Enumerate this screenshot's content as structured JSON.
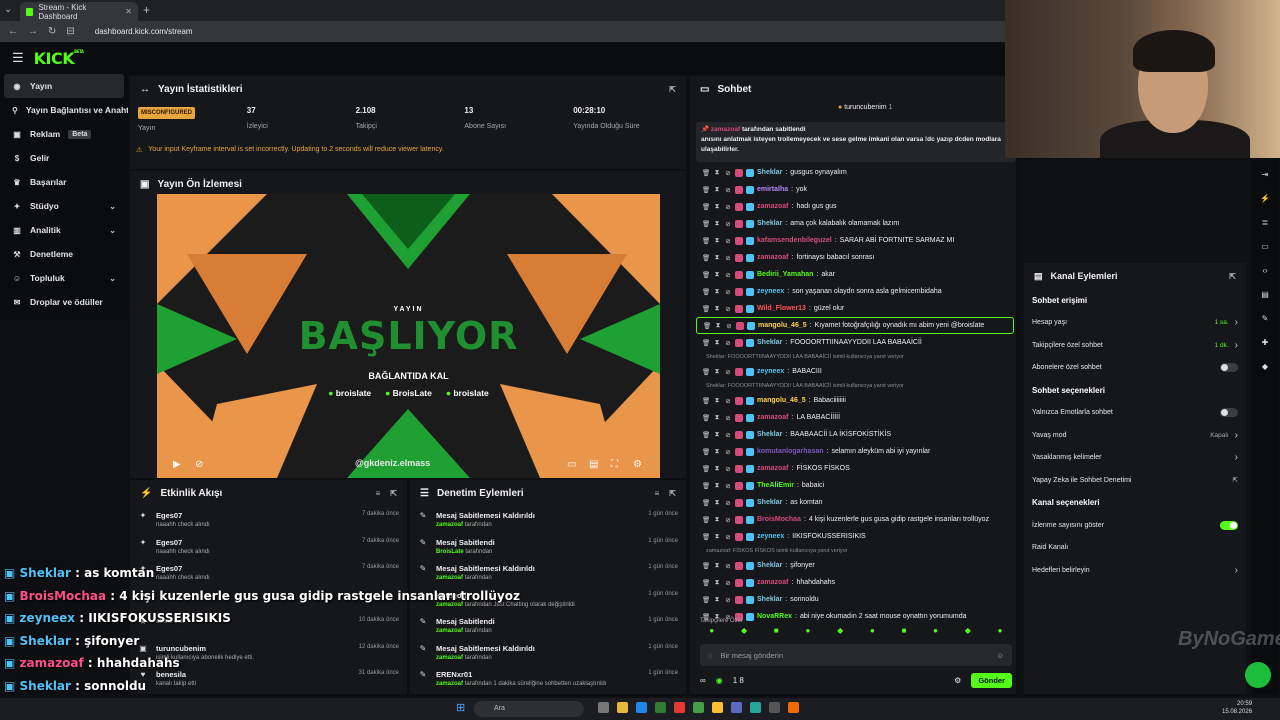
{
  "browser": {
    "tab_title": "Stream - Kick Dashboard",
    "url": "dashboard.kick.com/stream"
  },
  "brand": {
    "logo": "KICK",
    "beta": "BETA",
    "accent": "#53fc18"
  },
  "sidebar": {
    "items": [
      {
        "label": "Yayın",
        "icon": "broadcast-icon",
        "active": true
      },
      {
        "label": "Yayın Bağlantısı ve Anahtarı",
        "icon": "key-icon"
      },
      {
        "label": "Reklam",
        "icon": "ad-icon",
        "badge": "Beta"
      },
      {
        "label": "Gelir",
        "icon": "money-icon"
      },
      {
        "label": "Başarılar",
        "icon": "trophy-icon"
      },
      {
        "label": "Stüdyo",
        "icon": "studio-icon",
        "chevron": true
      },
      {
        "label": "Analitik",
        "icon": "chart-icon",
        "chevron": true
      },
      {
        "label": "Denetleme",
        "icon": "hammer-icon"
      },
      {
        "label": "Topluluk",
        "icon": "people-icon",
        "chevron": true
      },
      {
        "label": "Droplar ve ödüller",
        "icon": "gift-icon"
      }
    ]
  },
  "stats": {
    "title": "Yayın İstatistikleri",
    "status": "MISCONFIGURED",
    "items": [
      {
        "value": "",
        "label": "Yayın"
      },
      {
        "value": "37",
        "label": "İzleyici"
      },
      {
        "value": "2.108",
        "label": "Takipçi"
      },
      {
        "value": "13",
        "label": "Abone Sayısı"
      },
      {
        "value": "00:28:10",
        "label": "Yayında Olduğu Süre"
      }
    ],
    "warning": "Your input Keyframe interval is set incorrectly. Updating to 2 seconds will reduce viewer latency."
  },
  "preview": {
    "title": "Yayın Ön İzlemesi",
    "small": "YAYIN",
    "headline": "BAŞLIYOR",
    "sub": "BAĞLANTIDA KAL",
    "socials": [
      "broislate",
      "BroisLate",
      "broislate"
    ],
    "handle": "@gkdeniz.elmass"
  },
  "activity": {
    "title": "Etkinlik Akışı",
    "rows": [
      {
        "name": "Eges07",
        "detail": "naaahh check alındı",
        "time": "7 dakika önce"
      },
      {
        "name": "Eges07",
        "detail": "naaahh check alındı",
        "time": "7 dakika önce"
      },
      {
        "name": "Eges07",
        "detail": "naaahh check alındı",
        "time": "7 dakika önce"
      },
      {
        "name": "",
        "detail": "",
        "time": ""
      },
      {
        "name": "",
        "detail": "abone oldu",
        "time": "10 dakika önce"
      },
      {
        "name": "turuncubenim",
        "detail": "isimli kullanıcıya abonelik hediye etti.",
        "time": "12 dakika önce"
      },
      {
        "name": "benesila",
        "detail": "kanalı takip etti",
        "time": "31 dakika önce"
      }
    ]
  },
  "moderation": {
    "title": "Denetim Eylemleri",
    "rows": [
      {
        "action": "Mesaj Sabitlemesi Kaldırıldı",
        "by": "zamazoaf",
        "suffix": "tarafından",
        "time": "1 gün önce"
      },
      {
        "action": "Mesaj Sabitlendi",
        "by": "BroisLate",
        "suffix": "tarafından",
        "time": "1 gün önce"
      },
      {
        "action": "Mesaj Sabitlemesi Kaldırıldı",
        "by": "zamazoaf",
        "suffix": "tarafından",
        "time": "1 gün önce"
      },
      {
        "action": "Kategori",
        "by": "zamazoaf",
        "suffix": "tarafından Just Chatting olarak değiştirildi",
        "time": "1 gün önce"
      },
      {
        "action": "Mesaj Sabitlendi",
        "by": "zamazoaf",
        "suffix": "tarafından",
        "time": "1 gün önce"
      },
      {
        "action": "Mesaj Sabitlemesi Kaldırıldı",
        "by": "zamazoaf",
        "suffix": "tarafından",
        "time": "1 gün önce"
      },
      {
        "action": "ERENxr01",
        "by": "zamazoaf",
        "suffix": "tarafından 1 dakika süreliğine sohbetten uzaklaştırıldı",
        "time": "1 gün önce"
      }
    ]
  },
  "chat": {
    "title": "Sohbet",
    "top_user": "turuncubenim",
    "top_count": "1",
    "pinned_by": "tarafından sabitlendi",
    "pinned_text": "anısını anlatmak isteyen trollemeyecek ve sese gelme imkani olan varsa !dc yazıp dcden modlara ulaşabilirler.",
    "messages": [
      {
        "user": "Sheklar",
        "color": "#7ec8e3",
        "text": "gusgus oynayalım"
      },
      {
        "user": "emirtalha",
        "color": "#b28cff",
        "text": "yok"
      },
      {
        "user": "zamazoaf",
        "color": "#d54b7c",
        "text": "hadı gus gus"
      },
      {
        "user": "Sheklar",
        "color": "#7ec8e3",
        "text": "ama çok kalabalık olamamak lazım"
      },
      {
        "user": "kafamsendenbileguzel",
        "color": "#d54b7c",
        "text": "SARAR ABİ FORTNITE SARMAZ MI"
      },
      {
        "user": "zamazoaf",
        "color": "#d54b7c",
        "text": "fortinaysı babacıl sonrası"
      },
      {
        "user": "Bedirii_Yamahan",
        "color": "#53fc18",
        "text": "akar"
      },
      {
        "user": "zeyneex",
        "color": "#4fc3f7",
        "text": "son yaşanan olaydn sonra asla gelmicembidaha"
      },
      {
        "user": "Wild_Flower13",
        "color": "#ff5252",
        "text": "güzel olur"
      },
      {
        "user": "mangolu_46_5",
        "color": "#ffd54f",
        "text": "Kıyamet fotoğrafçılığı oynadık mı abim yeni @broislate",
        "hl": true
      },
      {
        "user": "Sheklar",
        "color": "#7ec8e3",
        "text": "FOOOORTTIINAAYYDDII LAA BABAAİCİİ"
      },
      {
        "reply": "Sheklar: FOOOORTTIINAAYYDDII LAA BABAAİCİİ isimli kullanıcıya yanıt veriyor"
      },
      {
        "user": "zeyneex",
        "color": "#4fc3f7",
        "text": "BABACIII"
      },
      {
        "reply": "Sheklar: FOOOORTTIINAAYYDDII LAA BABAAİCİİ isimli kullanıcıya yanıt veriyor"
      },
      {
        "user": "mangolu_46_5",
        "color": "#ffd54f",
        "text": "Babaciiiiiiii"
      },
      {
        "user": "zamazoaf",
        "color": "#d54b7c",
        "text": "LA BABACİİİİİ"
      },
      {
        "user": "Sheklar",
        "color": "#7ec8e3",
        "text": "BAABAACİİ LA İKİSFOKİSTİKİS"
      },
      {
        "user": "komutanlogarhasan",
        "color": "#7e57c2",
        "text": "selamın aleyküm abi iyi yayınlar"
      },
      {
        "user": "zamazoaf",
        "color": "#d54b7c",
        "text": "FİSKOS FİSKOS"
      },
      {
        "user": "TheAliEmir",
        "color": "#53fc18",
        "text": "babaici"
      },
      {
        "user": "Sheklar",
        "color": "#7ec8e3",
        "text": "as komtan"
      },
      {
        "user": "BroisMochaa",
        "color": "#d54b7c",
        "text": "4 kişi kuzenlerle gus gusa gidip rastgele insanları trollüyoz"
      },
      {
        "user": "zeyneex",
        "color": "#4fc3f7",
        "text": "IIKISFOKUSSERISIKIS"
      },
      {
        "reply": "zamazoaf: FİSKOS FİSKOS isimli kullanıcıya yanıt veriyor"
      },
      {
        "user": "Sheklar",
        "color": "#7ec8e3",
        "text": "şifonyer"
      },
      {
        "user": "zamazoaf",
        "color": "#d54b7c",
        "text": "hhahdahahs"
      },
      {
        "user": "Sheklar",
        "color": "#7ec8e3",
        "text": "sonnoldu"
      },
      {
        "user": "NovaRRex",
        "color": "#53fc18",
        "text": "abi niye okumadın 2 saat mouse oynattın yorumumda"
      }
    ],
    "followers_only": "Takipçilere Özel",
    "input_placeholder": "Bir mesaj gönderin",
    "points": "1 8",
    "send": "Gönder"
  },
  "channel_actions": {
    "title": "Kanal Eylemleri",
    "rows": [
      {
        "type": "sec",
        "label": "Sohbet erişimi"
      },
      {
        "type": "row",
        "label": "Hesap yaşı",
        "value": "1 sa.",
        "green": true,
        "chevron": true
      },
      {
        "type": "row",
        "label": "Takipçilere özel sohbet",
        "value": "1 dk.",
        "green": true,
        "chevron": true
      },
      {
        "type": "row",
        "label": "Abonelere özel sohbet",
        "toggle": "off"
      },
      {
        "type": "sec",
        "label": "Sohbet seçenekleri"
      },
      {
        "type": "row",
        "label": "Yalnızca Emotlarla sohbet",
        "toggle": "off"
      },
      {
        "type": "row",
        "label": "Yavaş mod",
        "value": "Kapalı",
        "chevron": true
      },
      {
        "type": "row",
        "label": "Yasaklanmış kelimeler",
        "chevron": true
      },
      {
        "type": "row",
        "label": "Yapay Zeka ile Sohbet Denetimi",
        "external": true
      },
      {
        "type": "sec",
        "label": "Kanal seçenekleri"
      },
      {
        "type": "row",
        "label": "İzlenme sayısını göster",
        "toggle": "on"
      },
      {
        "type": "row",
        "label": "Raid Kanalı"
      },
      {
        "type": "row",
        "label": "Hedefleri belirleyin",
        "chevron": true
      }
    ]
  },
  "overlay": {
    "lines": [
      {
        "user": "Sheklar",
        "color": "#4fc3f7",
        "text": "as komtan"
      },
      {
        "user": "BroisMochaa",
        "color": "#ff4f8b",
        "text": "4 kişi kuzenlerle gus gusa gidip rastgele insanları trollüyoz"
      },
      {
        "user": "zeyneex",
        "color": "#4fc3f7",
        "text": "IIKISFOKUSSERISIKIS"
      },
      {
        "user": "Sheklar",
        "color": "#4fc3f7",
        "text": "şifonyer"
      },
      {
        "user": "zamazoaf",
        "color": "#ff4f8b",
        "text": "hhahdahahs"
      },
      {
        "user": "Sheklar",
        "color": "#4fc3f7",
        "text": "sonnoldu"
      },
      {
        "user": "NovaRRex",
        "color": "#ffffff",
        "text": "abi niye okumadın 2 saat mouse oynattın yorumumda"
      }
    ]
  },
  "watermark": "ByNoGame",
  "taskbar": {
    "search": "Ara",
    "time": "20:59",
    "date": "15.08.2026"
  }
}
